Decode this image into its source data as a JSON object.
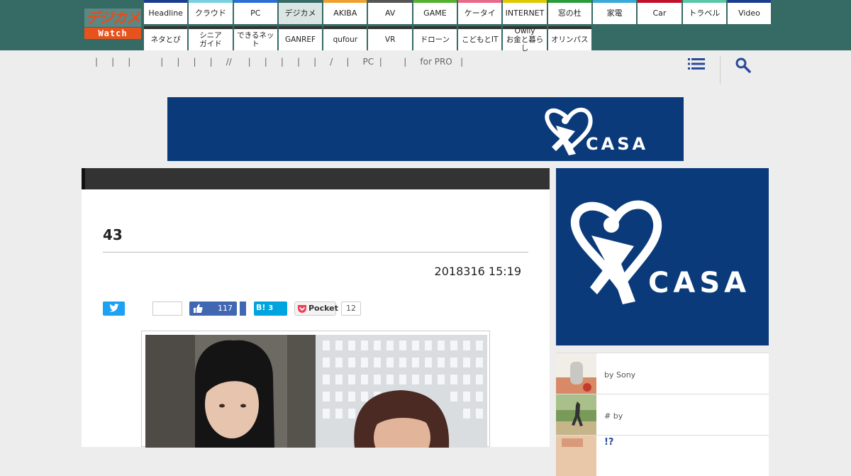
{
  "logo": {
    "top": "デジカメ",
    "bottom": "Watch"
  },
  "nav_row1": [
    {
      "label": "Headline",
      "color": "#1a3d8f"
    },
    {
      "label": "クラウド",
      "color": "#7ad0e0"
    },
    {
      "label": "PC",
      "color": "#2a6fd6"
    },
    {
      "label": "デジカメ",
      "color": "#356a65"
    },
    {
      "label": "AKIBA",
      "color": "#f0a030"
    },
    {
      "label": "AV",
      "color": "#555555"
    },
    {
      "label": "GAME",
      "color": "#55b030"
    },
    {
      "label": "ケータイ",
      "color": "#e86a8a"
    },
    {
      "label": "INTERNET",
      "color": "#e0c800"
    },
    {
      "label": "窓の杜",
      "color": "#2a9a3a"
    },
    {
      "label": "家電",
      "color": "#3aa8d8"
    },
    {
      "label": "Car",
      "color": "#c0102a"
    },
    {
      "label": "トラベル",
      "color": "#5ac8a8"
    },
    {
      "label": "Video",
      "color": "#1a3d8f"
    }
  ],
  "nav_row2": [
    {
      "label": "ネタとぴ"
    },
    {
      "label": "シニア\nガイド"
    },
    {
      "label": "できるネット"
    },
    {
      "label": "GANREF"
    },
    {
      "label": "qufour"
    },
    {
      "label": "VR"
    },
    {
      "label": "ドローン"
    },
    {
      "label": "こどもとIT"
    },
    {
      "label": "Owlly\nお金と暮らし"
    },
    {
      "label": "オリンパス"
    }
  ],
  "crumbs": "|     |     |           |     |     |     |     //      |     |     |     |     |     /     |     PC  |        |     for PRO   |",
  "banner_ad": {
    "brand": "CASA"
  },
  "side_ad": {
    "brand": "CASA"
  },
  "article": {
    "title": "43",
    "date": "2018316 15:19"
  },
  "share": {
    "facebook_count": "117",
    "hatena_label": "B!",
    "hatena_count": "3",
    "pocket_label": "Pocket",
    "pocket_count": "12"
  },
  "side_items": [
    {
      "text": "by Sony"
    },
    {
      "text": "# by"
    },
    {
      "text": "!?"
    }
  ]
}
